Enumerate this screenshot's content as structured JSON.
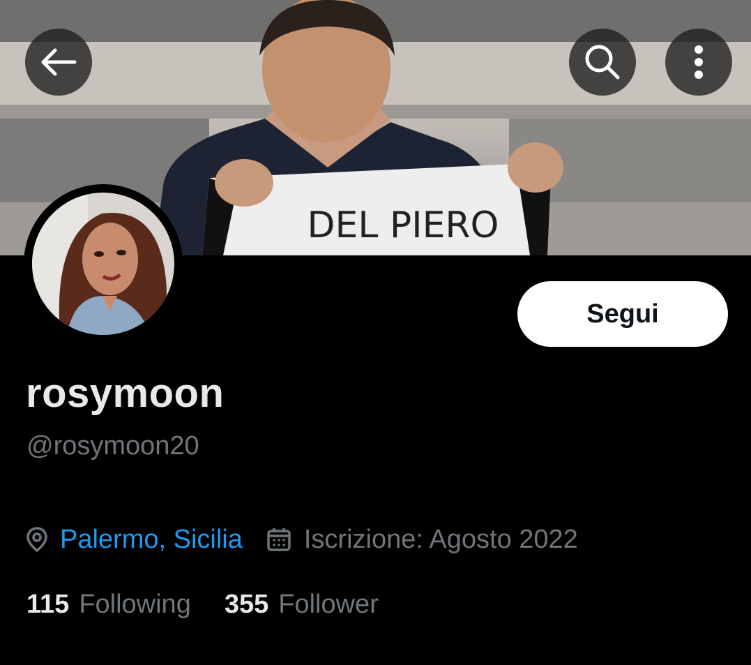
{
  "banner": {
    "jersey_text": "DEL PIERO"
  },
  "header": {
    "back_icon": "arrow-left-icon",
    "search_icon": "search-icon",
    "more_icon": "more-vertical-icon"
  },
  "profile": {
    "display_name": "rosymoon",
    "handle": "@rosymoon20",
    "follow_label": "Segui",
    "location": "Palermo, Sicilia",
    "location_icon": "location-pin-icon",
    "joined": "Iscrizione: Agosto 2022",
    "joined_icon": "calendar-icon"
  },
  "stats": {
    "following_count": "115",
    "following_label": "Following",
    "followers_count": "355",
    "followers_label": "Follower"
  },
  "colors": {
    "background": "#000000",
    "link": "#1d9bf0",
    "secondary_text": "#71767b",
    "primary_text": "#e7e9ea"
  }
}
